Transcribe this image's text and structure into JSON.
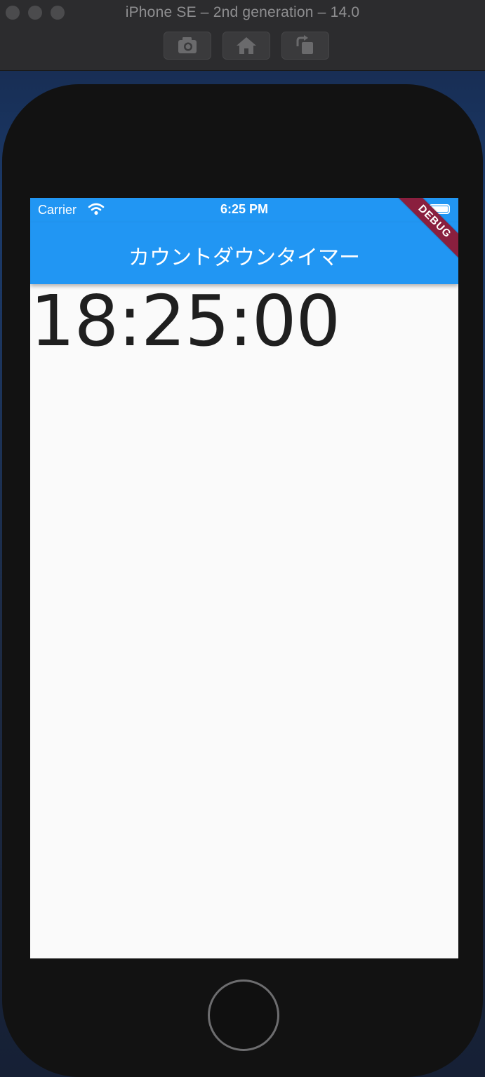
{
  "simulator": {
    "title": "iPhone SE – 2nd generation – 14.0",
    "toolbar": {
      "screenshot_icon": "camera-icon",
      "home_icon": "home-icon",
      "rotate_icon": "rotate-icon"
    }
  },
  "status_bar": {
    "carrier": "Carrier",
    "time": "6:25 PM"
  },
  "app_bar": {
    "title": "カウントダウンタイマー"
  },
  "main": {
    "timer": "18:25:00"
  },
  "debug_banner": {
    "label": "DEBUG"
  },
  "colors": {
    "primary": "#2196f3",
    "debug_banner": "#8a1f3e",
    "background": "#fafafa",
    "timer_text": "#1f1f1f"
  }
}
